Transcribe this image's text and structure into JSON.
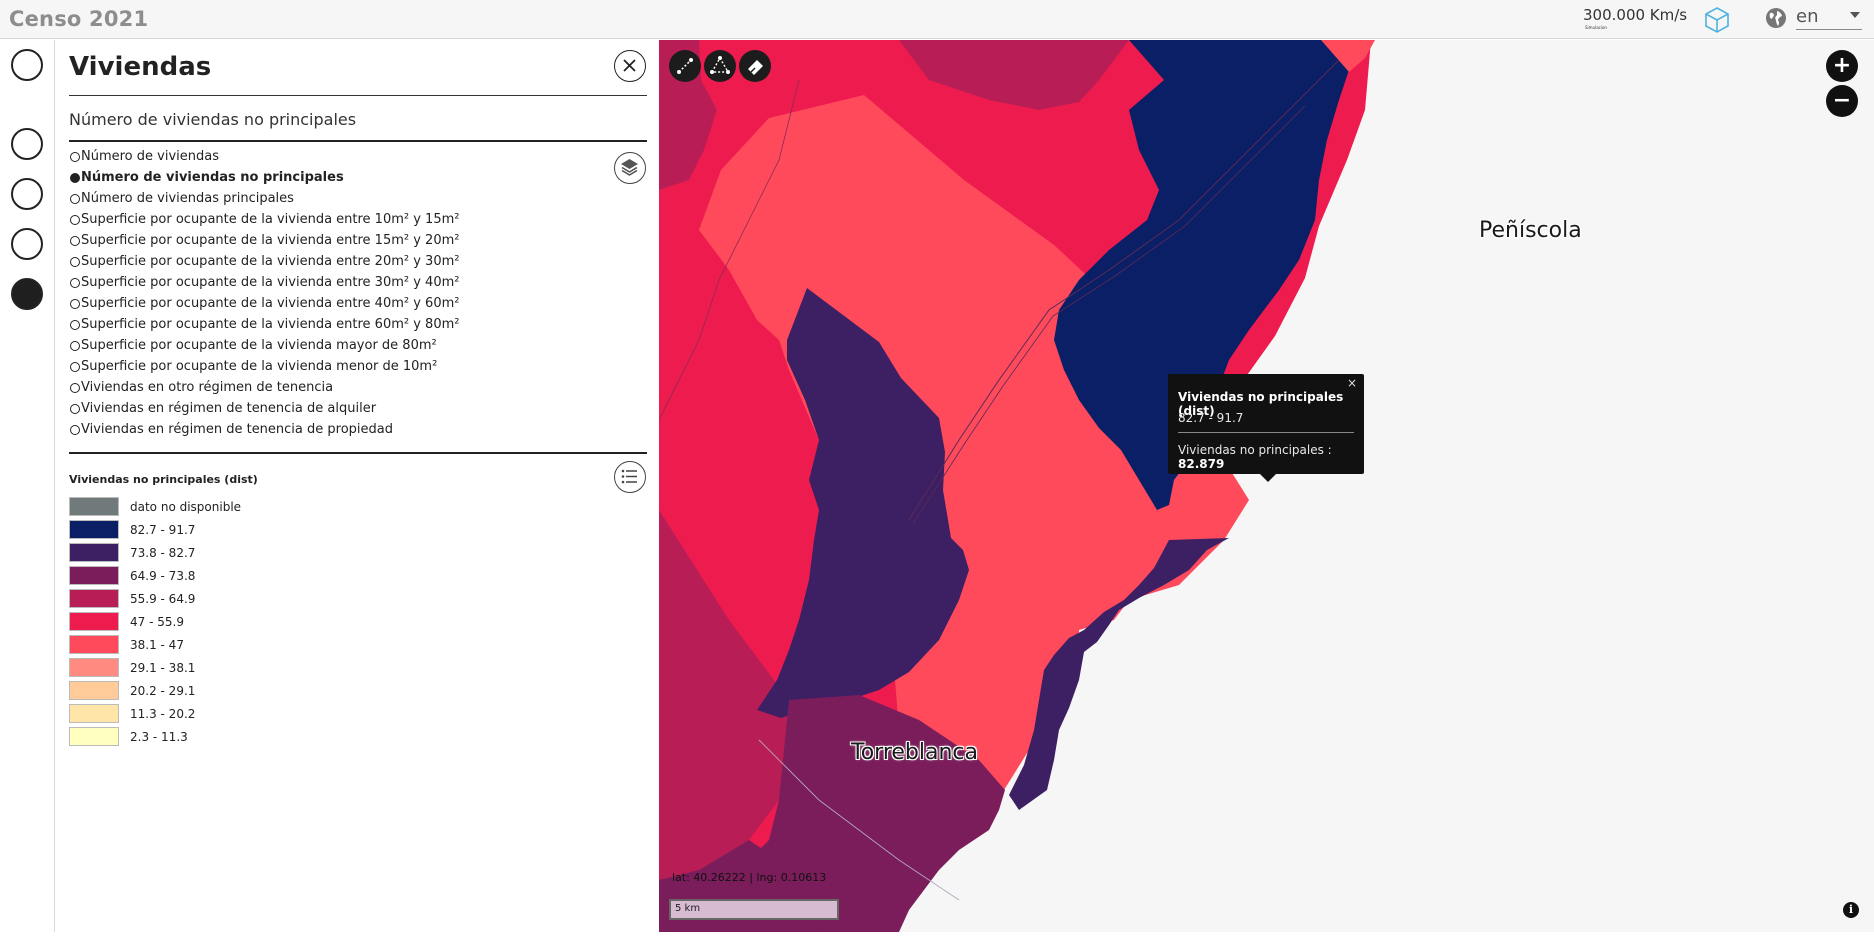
{
  "header": {
    "app_title": "Censo 2021",
    "scale_readout": "300.000 Km/s",
    "scale_sub": "Simulacion",
    "language": "en"
  },
  "rail": {
    "items": [
      {
        "name": "section-1",
        "active": false
      },
      {
        "name": "section-2",
        "active": false
      },
      {
        "name": "section-3",
        "active": false
      },
      {
        "name": "section-4",
        "active": false
      },
      {
        "name": "section-5",
        "active": true
      }
    ]
  },
  "panel": {
    "title": "Viviendas",
    "subtitle": "Número de viviendas no principales",
    "variables": [
      {
        "label": "Número de viviendas",
        "selected": false
      },
      {
        "label": "Número de viviendas no principales",
        "selected": true
      },
      {
        "label": "Número de viviendas principales",
        "selected": false
      },
      {
        "label": "Superficie por ocupante de la vivienda entre 10m² y 15m²",
        "selected": false
      },
      {
        "label": "Superficie por ocupante de la vivienda entre 15m² y 20m²",
        "selected": false
      },
      {
        "label": "Superficie por ocupante de la vivienda entre 20m² y 30m²",
        "selected": false
      },
      {
        "label": "Superficie por ocupante de la vivienda entre 30m² y 40m²",
        "selected": false
      },
      {
        "label": "Superficie por ocupante de la vivienda entre 40m² y 60m²",
        "selected": false
      },
      {
        "label": "Superficie por ocupante de la vivienda entre 60m² y 80m²",
        "selected": false
      },
      {
        "label": "Superficie por ocupante de la vivienda mayor de 80m²",
        "selected": false
      },
      {
        "label": "Superficie por ocupante de la vivienda menor de 10m²",
        "selected": false
      },
      {
        "label": "Viviendas en otro régimen de tenencia",
        "selected": false
      },
      {
        "label": "Viviendas en régimen de tenencia de alquiler",
        "selected": false
      },
      {
        "label": "Viviendas en régimen de tenencia de propiedad",
        "selected": false
      }
    ],
    "legend_title": "Viviendas no principales (dist)",
    "legend": [
      {
        "label": "dato no disponible",
        "color": "#707a7a"
      },
      {
        "label": "82.7 - 91.7",
        "color": "#0b1f66"
      },
      {
        "label": "73.8 - 82.7",
        "color": "#3d1f63"
      },
      {
        "label": "64.9 - 73.8",
        "color": "#7a1d5a"
      },
      {
        "label": "55.9 - 64.9",
        "color": "#b81e55"
      },
      {
        "label": "47 - 55.9",
        "color": "#ee1c4e"
      },
      {
        "label": "38.1 - 47",
        "color": "#ff4a5c"
      },
      {
        "label": "29.1 - 38.1",
        "color": "#ff8a80"
      },
      {
        "label": "20.2 - 29.1",
        "color": "#ffcc99"
      },
      {
        "label": "11.3 - 20.2",
        "color": "#ffe5a8"
      },
      {
        "label": "2.3 - 11.3",
        "color": "#ffffc0"
      }
    ]
  },
  "map": {
    "towns": [
      "Peñíscola",
      "Torreblanca"
    ],
    "popup": {
      "title": "Viviendas no principales (dist)",
      "range": "82.7 - 91.7",
      "value_label": "Viviendas no principales : ",
      "value": "82.879",
      "close": "×"
    },
    "coords": "lat: 40.26222 | lng: 0.10613",
    "scalebar": "5 km",
    "zoom_in": "+",
    "zoom_out": "−",
    "info": "i",
    "tools": [
      "measure-line-icon",
      "measure-area-icon",
      "eraser-icon"
    ]
  }
}
